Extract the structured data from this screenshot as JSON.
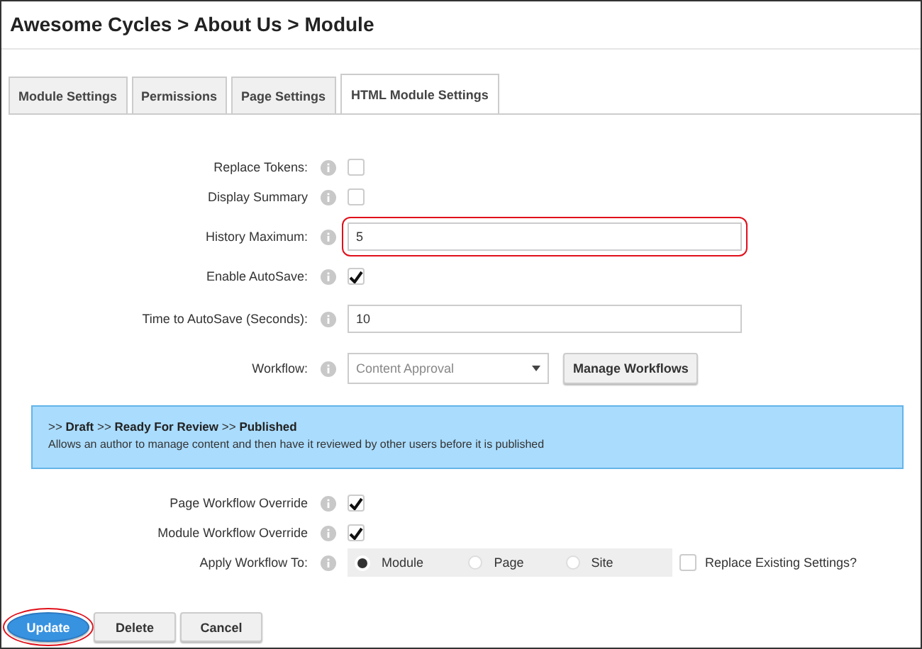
{
  "window": {
    "title": "Awesome Cycles > About Us > Module"
  },
  "tabs": [
    {
      "label": "Module Settings",
      "selected": false
    },
    {
      "label": "Permissions",
      "selected": false
    },
    {
      "label": "Page Settings",
      "selected": false
    },
    {
      "label": "HTML Module Settings",
      "selected": true
    }
  ],
  "settings": [
    {
      "kind": "checkbox",
      "label": "Replace Tokens:",
      "checked": false
    },
    {
      "kind": "checkbox",
      "label": "Display Summary",
      "checked": false
    },
    {
      "kind": "text",
      "label": "History Maximum:",
      "value": "5",
      "highlighted": true
    },
    {
      "kind": "checkbox",
      "label": "Enable AutoSave:",
      "checked": true
    },
    {
      "kind": "text",
      "label": "Time to AutoSave (Seconds):",
      "value": "10",
      "highlighted": false
    },
    {
      "kind": "select",
      "label": "Workflow:",
      "value": "Content Approval",
      "button": "Manage Workflows"
    }
  ],
  "workflow_info": {
    "steps": ">> **Draft** >> **Ready For Review** >> **Published**",
    "description": "Allows an author to manage content and then have it reviewed by other users before it is published"
  },
  "overrides": [
    {
      "kind": "checkbox",
      "label": "Page Workflow Override",
      "checked": true
    },
    {
      "kind": "checkbox",
      "label": "Module Workflow Override",
      "checked": true
    },
    {
      "kind": "radio",
      "label": "Apply Workflow To:",
      "options": [
        {
          "label": "Module",
          "selected": true
        },
        {
          "label": "Page",
          "selected": false
        },
        {
          "label": "Site",
          "selected": false
        }
      ],
      "extra": {
        "label": "Replace Existing Settings?",
        "checked": false
      }
    }
  ],
  "buttons": [
    {
      "label": "Update",
      "kind": "primary",
      "highlighted": true
    },
    {
      "label": "Delete",
      "kind": "default",
      "highlighted": false
    },
    {
      "label": "Cancel",
      "kind": "default",
      "highlighted": false
    }
  ]
}
